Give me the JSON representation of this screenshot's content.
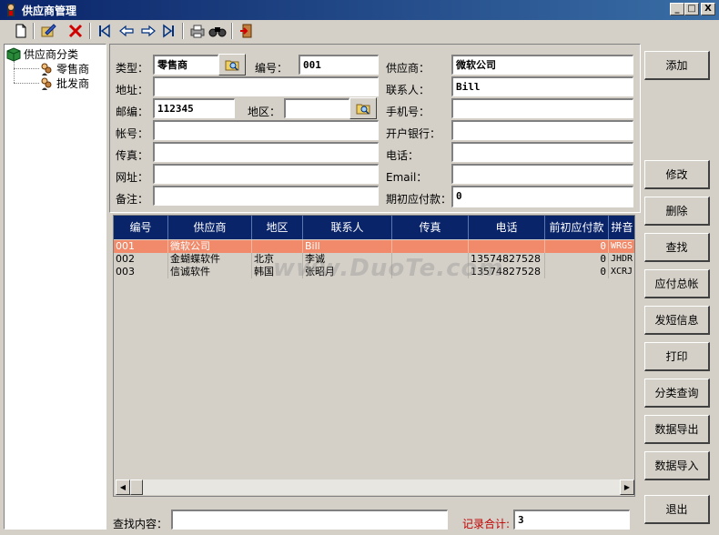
{
  "window": {
    "title": "供应商管理",
    "minimize": "_",
    "maximize": "□",
    "close": "X"
  },
  "toolbar": {
    "icons": [
      "new-icon",
      "edit-icon",
      "delete-icon",
      "first-record-icon",
      "prev-record-icon",
      "next-record-icon",
      "last-record-icon",
      "print-icon",
      "find-icon",
      "exit-icon"
    ]
  },
  "tree": {
    "root": "供应商分类",
    "children": [
      "零售商",
      "批发商"
    ]
  },
  "form": {
    "type_label": "类型：",
    "type_value": "零售商",
    "code_label": "编号：",
    "code_value": "001",
    "supplier_label": "供应商：",
    "supplier_value": "微软公司",
    "address_label": "地址：",
    "address_value": "",
    "contact_label": "联系人：",
    "contact_value": "Bill",
    "zip_label": "邮编：",
    "zip_value": "112345",
    "region_label": "地区：",
    "region_value": "",
    "mobile_label": "手机号：",
    "mobile_value": "",
    "account_label": "帐号：",
    "account_value": "",
    "bank_label": "开户银行：",
    "bank_value": "",
    "fax_label": "传真：",
    "fax_value": "",
    "phone_label": "电话：",
    "phone_value": "",
    "website_label": "网址：",
    "website_value": "",
    "email_label": "Email：",
    "email_value": "",
    "note_label": "备注：",
    "note_value": "",
    "initial_payable_label": "期初应付款：",
    "initial_payable_value": "0"
  },
  "grid": {
    "columns": [
      "编号",
      "供应商",
      "地区",
      "联系人",
      "传真",
      "电话",
      "前初应付款",
      "拼音"
    ],
    "rows": [
      {
        "code": "001",
        "supplier": "微软公司",
        "region": "",
        "contact": "Bill",
        "fax": "",
        "phone": "",
        "payable": "0",
        "pinyin": "WRGS"
      },
      {
        "code": "002",
        "supplier": "金蝴蝶软件",
        "region": "北京",
        "contact": "李诚",
        "fax": "",
        "phone": "13574827528",
        "payable": "0",
        "pinyin": "JHDR"
      },
      {
        "code": "003",
        "supplier": "信诚软件",
        "region": "韩国",
        "contact": "张昭月",
        "fax": "",
        "phone": "13574827528",
        "payable": "0",
        "pinyin": "XCRJ"
      }
    ],
    "selected_row": 0
  },
  "buttons": {
    "add": "添加",
    "modify": "修改",
    "delete": "删除",
    "find": "查找",
    "payable_total": "应付总帐",
    "send_sms": "发短信息",
    "print": "打印",
    "category_query": "分类查询",
    "export": "数据导出",
    "import": "数据导入",
    "exit": "退出"
  },
  "footer": {
    "search_label": "查找内容：",
    "search_value": "",
    "record_total_label": "记录合计:",
    "record_total_value": "3"
  },
  "watermark": "www.DuoTe.com",
  "colors": {
    "title_bar": "#0a246a",
    "grid_header": "#0a246a",
    "selected_row": "#f08a6a",
    "record_total_label": "#c00000"
  }
}
